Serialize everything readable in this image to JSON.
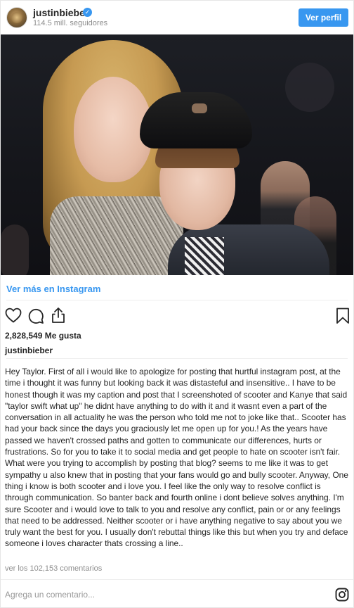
{
  "header": {
    "username": "justinbieber",
    "followers": "114.5 mill. seguidores",
    "profile_button": "Ver perfil"
  },
  "view_more": "Ver más en Instagram",
  "likes": "2,828,549 Me gusta",
  "caption_user": "justinbieber",
  "caption": "Hey Taylor. First of all i would like to apologize for posting that hurtful instagram post, at the time i thought it was funny but looking back it was distasteful and insensitive.. I have to be honest though it was my caption and post that I screenshoted of scooter and Kanye that said \"taylor swift what up\" he didnt have anything to do with it and it wasnt even a part of the conversation in all actuality he was the person who told me not to joke like that.. Scooter has had your back since the days you graciously let me open up for you.! As the years have passed we haven't crossed paths and gotten to communicate our differences, hurts or frustrations. So for you to take it to social media and get people to hate on scooter isn't fair. What were you trying to accomplish by posting that blog? seems to me like it was to get sympathy u also knew that in posting that your fans would go and bully scooter. Anyway, One thing i know is both scooter and i love you. I feel like the only way to resolve conflict is through communication. So banter back and fourth online i dont believe solves anything. I'm sure Scooter and i would love to talk to you and resolve any conflict, pain or or any feelings that need to be addressed. Neither scooter or i have anything negative to say about you we truly want the best for you. I usually don't rebuttal things like this but when you try and deface someone i loves character thats crossing a line..",
  "view_comments": "ver los 102,153 comentarios",
  "comment_placeholder": "Agrega un comentario...",
  "icons": {
    "verified": "verified-badge-icon",
    "like": "heart-icon",
    "comment": "comment-icon",
    "share": "share-icon",
    "save": "bookmark-icon",
    "brand": "instagram-icon"
  },
  "colors": {
    "accent": "#3897f0",
    "text": "#262626",
    "muted": "#8e8e8e"
  }
}
